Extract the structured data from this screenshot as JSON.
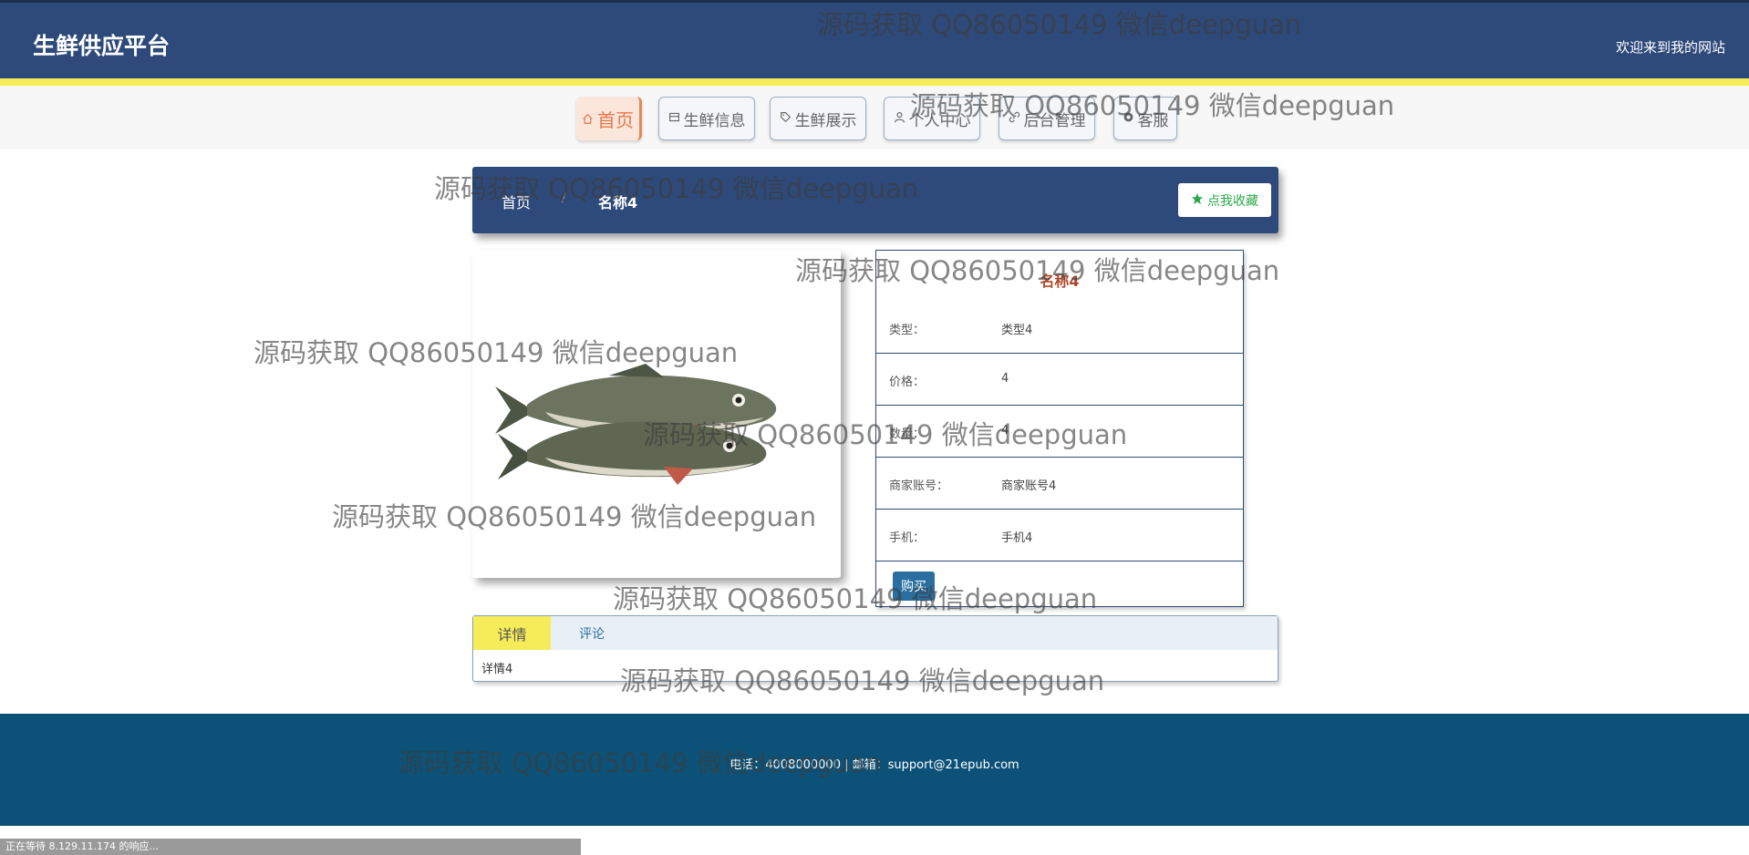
{
  "header": {
    "site_title": "生鲜供应平台",
    "welcome": "欢迎来到我的网站",
    "accent_color": "#2e4a7a",
    "stripe_color": "#f5ec5a"
  },
  "nav": {
    "items": [
      {
        "label": "首页",
        "icon": "home-icon",
        "active": true
      },
      {
        "label": "生鲜信息",
        "icon": "box-icon"
      },
      {
        "label": "生鲜展示",
        "icon": "tag-icon"
      },
      {
        "label": "个人中心",
        "icon": "user-icon"
      },
      {
        "label": "后台管理",
        "icon": "link-icon"
      },
      {
        "label": "客服",
        "icon": "chat-icon"
      }
    ]
  },
  "breadcrumb": {
    "home": "首页",
    "separator": "/",
    "current": "名称4",
    "favorite_label": "点我收藏"
  },
  "product": {
    "image_alt": "fish",
    "title": "名称4",
    "fields": [
      {
        "label": "类型：",
        "value": "类型4"
      },
      {
        "label": "价格：",
        "value": "4"
      },
      {
        "label": "数量：",
        "value": "4"
      },
      {
        "label": "商家账号：",
        "value": "商家账号4"
      },
      {
        "label": "手机：",
        "value": "手机4"
      }
    ],
    "buy_label": "购买"
  },
  "tabs": {
    "items": [
      {
        "label": "详情",
        "active": true
      },
      {
        "label": "评论"
      }
    ],
    "content": "详情4"
  },
  "footer": {
    "text": "电话：4008000000 | 邮箱：support@21epub.com"
  },
  "statusbar": {
    "text": "正在等待 8.129.11.174 的响应..."
  },
  "watermark": {
    "text": "源码获取 QQ86050149 微信deepguan"
  }
}
